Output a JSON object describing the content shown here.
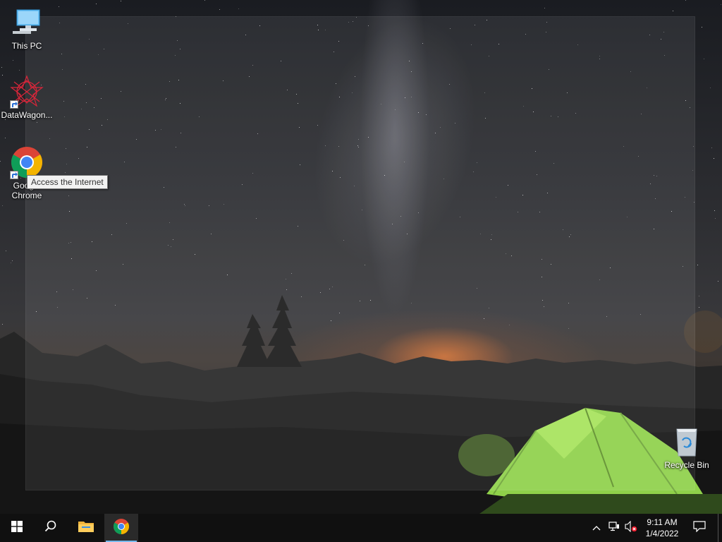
{
  "desktop": {
    "icons": [
      {
        "label": "This PC"
      },
      {
        "label": "DataWagon..."
      },
      {
        "label": "Google Chrome"
      },
      {
        "label": "Recycle Bin"
      }
    ],
    "tooltip": "Access the Internet"
  },
  "taskbar": {
    "start_icon": "windows-logo-icon",
    "search_icon": "search-icon",
    "pinned": [
      {
        "name": "file-explorer",
        "icon": "folder-icon"
      },
      {
        "name": "google-chrome",
        "icon": "chrome-icon",
        "active": true
      }
    ],
    "tray_icons": [
      "chevron-up-icon",
      "network-icon",
      "volume-muted-icon"
    ],
    "clock": {
      "time": "9:11 AM",
      "date": "1/4/2022"
    },
    "notification_icon": "action-center-icon"
  },
  "colors": {
    "taskbar_bg": "#101010",
    "active_indicator": "#76b9ed",
    "tent_green": "#8fd14a"
  }
}
